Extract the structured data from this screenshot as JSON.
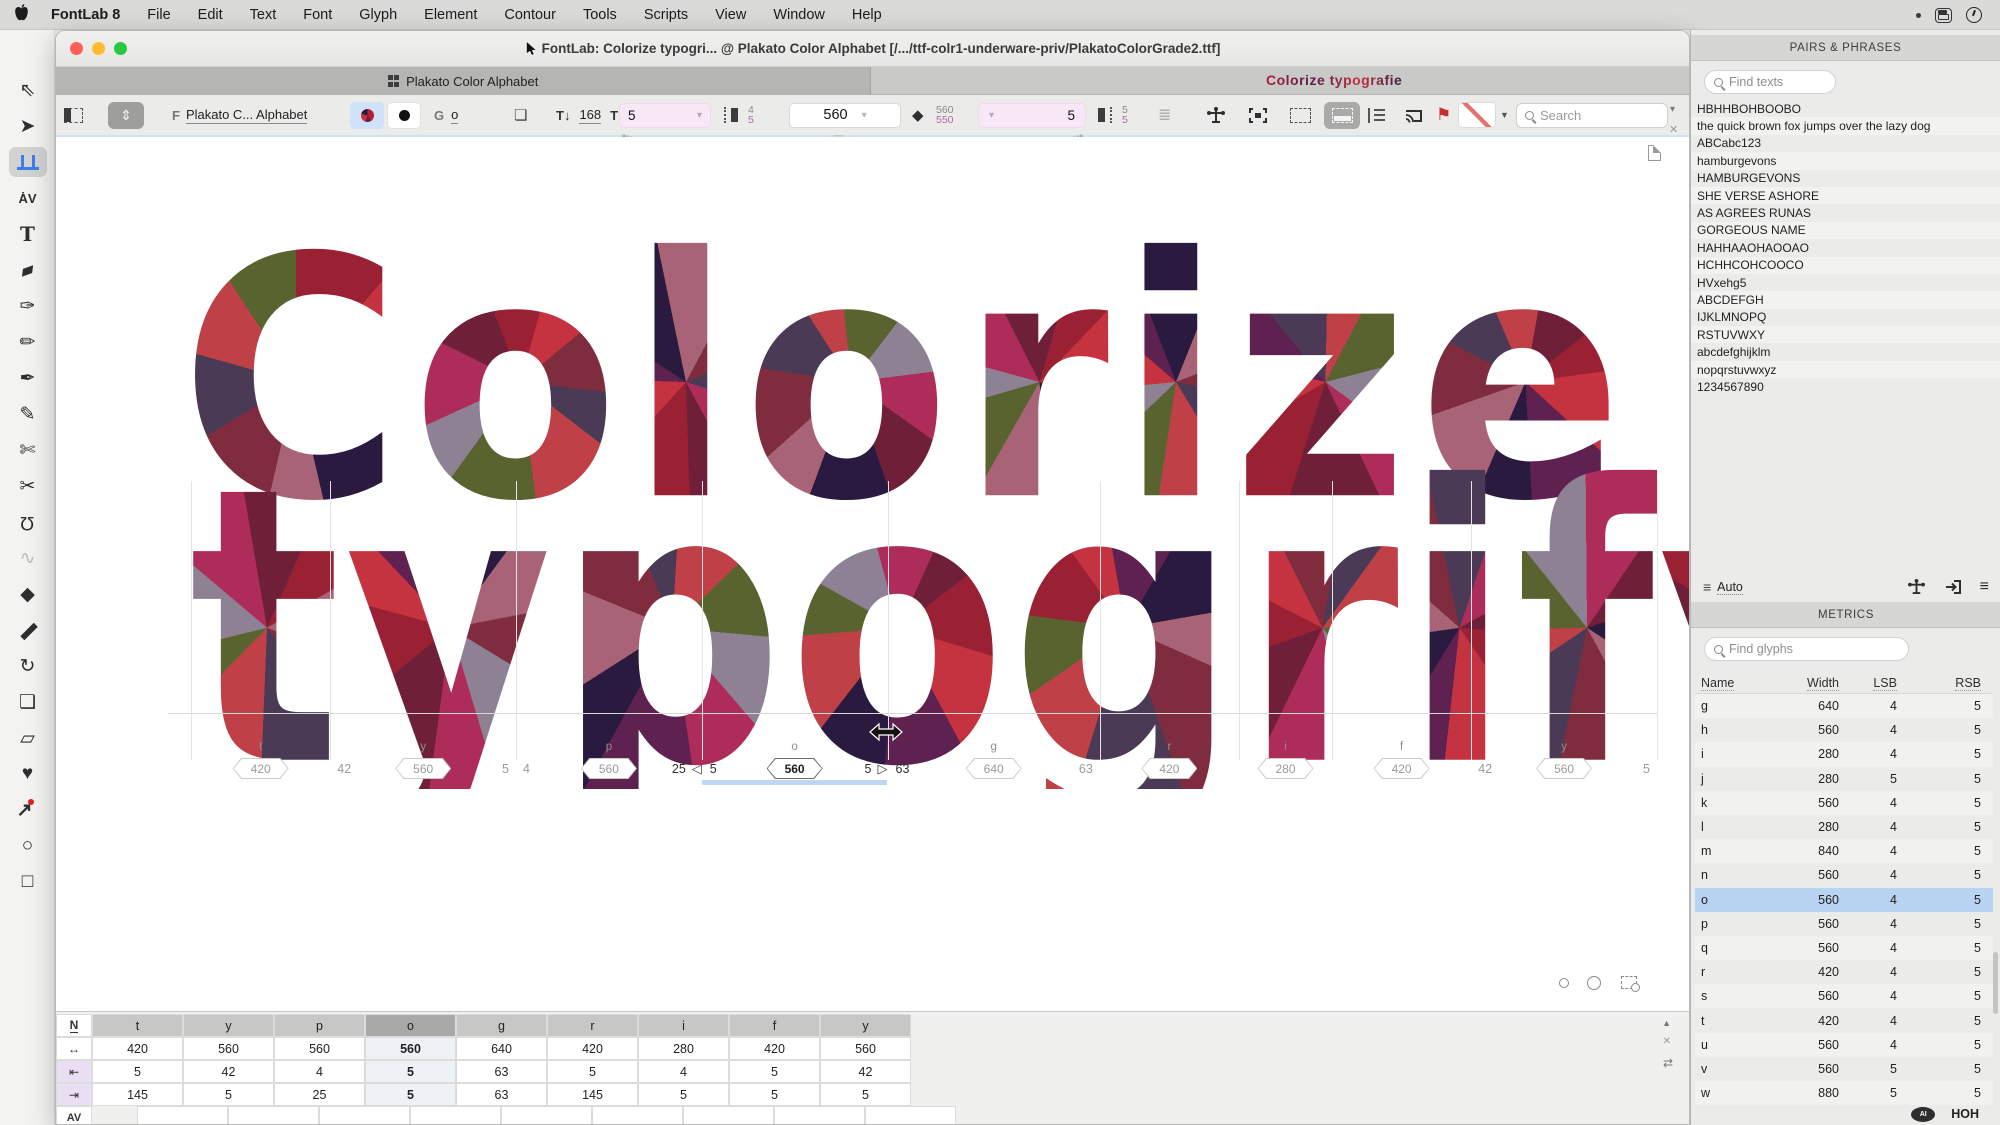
{
  "menu_bar": {
    "app_name": "FontLab 8",
    "items": [
      "File",
      "Edit",
      "Text",
      "Font",
      "Glyph",
      "Element",
      "Contour",
      "Tools",
      "Scripts",
      "View",
      "Window",
      "Help"
    ]
  },
  "titlebar": {
    "title": "FontLab: Colorize typogri... @ Plakato Color Alphabet [/.../ttf-colr1-underware-priv/PlakatoColorGrade2.ttf]"
  },
  "tabbar": {
    "tab_label": "Plakato Color Alphabet",
    "preview_text": "Colorize typografie"
  },
  "toolbar": {
    "font_prefix": "F",
    "font_name": "Plakato C... Alphabet",
    "glyph_prefix": "G",
    "glyph_name": "o",
    "text_size": "168",
    "tsize_down": "T↓",
    "tsize_up": "T↑",
    "lsb_value": "5",
    "lsb_alt_top": "4",
    "lsb_alt_bottom": "5",
    "width_value": "560",
    "width_alt_top": "560",
    "width_alt_bottom": "550",
    "rsb_value": "5",
    "rsb_alt_top": "5",
    "rsb_alt_bottom": "5",
    "search_placeholder": "Search"
  },
  "tools": [
    "pointer",
    "element",
    "metrics",
    "kerning",
    "text",
    "eraser",
    "brush",
    "pencil",
    "pen",
    "rapid",
    "knife",
    "scissors",
    "magnet",
    "tweak",
    "fill",
    "ruler",
    "rotate",
    "scale",
    "slant",
    "blob",
    "eyedropper",
    "ellipse",
    "rectangle"
  ],
  "tools_selected_index": 2,
  "canvas": {
    "line1": "Colorize",
    "line2": "typogrify",
    "palette": [
      "#9a2134",
      "#c63340",
      "#5e2150",
      "#2a1a40",
      "#a86476",
      "#7f2d3e",
      "#4a3a55",
      "#bf4047",
      "#59632f",
      "#8d8193",
      "#ae2c5a",
      "#6f2038"
    ],
    "glyph_columns": [
      {
        "name": "t",
        "width": "420"
      },
      {
        "name": "y",
        "width": "560"
      },
      {
        "name": "p",
        "width": "560"
      },
      {
        "name": "o",
        "width": "560",
        "selected": true
      },
      {
        "name": "g",
        "width": "640"
      },
      {
        "name": "r",
        "width": "420"
      },
      {
        "name": "i",
        "width": "280"
      },
      {
        "name": "f",
        "width": "420"
      },
      {
        "name": "y",
        "width": "560"
      }
    ],
    "boundary_numbers": [
      {
        "index": 1,
        "right": "42"
      },
      {
        "index": 2,
        "left": "5",
        "right": "4"
      },
      {
        "index": 3,
        "left": "25",
        "handle": "left",
        "right": "5",
        "dark": true
      },
      {
        "index": 4,
        "left": "5",
        "handle": "right",
        "right": "63",
        "dark": true
      },
      {
        "index": 5,
        "left": "63"
      },
      {
        "index": 8,
        "right": "42"
      },
      {
        "index": 9,
        "left": "5"
      }
    ]
  },
  "pairs_panel": {
    "title": "PAIRS & PHRASES",
    "search_placeholder": "Find texts",
    "items": [
      "HBHHBOHBOOBO",
      "the quick brown fox jumps over the lazy dog",
      "ABCabc123",
      "hamburgevons",
      "HAMBURGEVONS",
      "SHE VERSE ASHORE",
      "AS AGREES RUNAS",
      "GORGEOUS NAME",
      "HAHHAAOHAOOAO",
      "HCHHCOHCOOCO",
      "HVxehg5",
      "ABCDEFGH",
      "IJKLMNOPQ",
      "RSTUVWXY",
      "abcdefghijklm",
      "nopqrstuvwxyz",
      "1234567890"
    ]
  },
  "auto_bar": {
    "label": "Auto"
  },
  "metrics_panel": {
    "title": "METRICS",
    "search_placeholder": "Find glyphs",
    "columns": [
      "Name",
      "Width",
      "LSB",
      "RSB"
    ],
    "rows": [
      [
        "g",
        "640",
        "4",
        "5"
      ],
      [
        "h",
        "560",
        "4",
        "5"
      ],
      [
        "i",
        "280",
        "4",
        "5"
      ],
      [
        "j",
        "280",
        "5",
        "5"
      ],
      [
        "k",
        "560",
        "4",
        "5"
      ],
      [
        "l",
        "280",
        "4",
        "5"
      ],
      [
        "m",
        "840",
        "4",
        "5"
      ],
      [
        "n",
        "560",
        "4",
        "5"
      ],
      [
        "o",
        "560",
        "4",
        "5"
      ],
      [
        "p",
        "560",
        "4",
        "5"
      ],
      [
        "q",
        "560",
        "4",
        "5"
      ],
      [
        "r",
        "420",
        "4",
        "5"
      ],
      [
        "s",
        "560",
        "4",
        "5"
      ],
      [
        "t",
        "420",
        "4",
        "5"
      ],
      [
        "u",
        "560",
        "4",
        "5"
      ],
      [
        "v",
        "560",
        "5",
        "5"
      ],
      [
        "w",
        "880",
        "5",
        "5"
      ]
    ],
    "selected_row": "o",
    "footer_button": "HOH"
  },
  "bottom_table": {
    "corner_label": "N",
    "columns": [
      "t",
      "y",
      "p",
      "o",
      "g",
      "r",
      "i",
      "f",
      "y"
    ],
    "selected_index": 3,
    "rows": [
      {
        "label": "↔",
        "values": [
          "420",
          "560",
          "560",
          "560",
          "640",
          "420",
          "280",
          "420",
          "560"
        ]
      },
      {
        "label": "⇤",
        "values": [
          "5",
          "42",
          "4",
          "5",
          "63",
          "5",
          "4",
          "5",
          "42"
        ]
      },
      {
        "label": "⇥",
        "values": [
          "145",
          "5",
          "25",
          "5",
          "63",
          "145",
          "5",
          "5",
          "5"
        ]
      },
      {
        "label": "AV",
        "values": [
          "",
          "",
          "",
          "",
          "",
          "",
          "",
          "",
          ""
        ]
      }
    ]
  },
  "colors": {
    "accent_blue": "#b9d3f2",
    "selection_underline": "#bdd8f2",
    "flag_red": "#c82f2f",
    "traffic": [
      "#ff5f57",
      "#febc2e",
      "#28c840"
    ]
  }
}
